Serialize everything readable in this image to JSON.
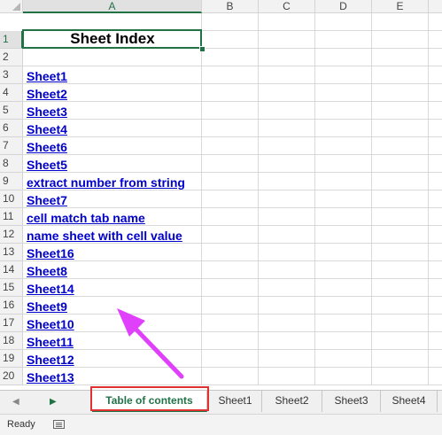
{
  "columns": [
    "A",
    "B",
    "C",
    "D",
    "E"
  ],
  "rows": [
    "1",
    "2",
    "3",
    "4",
    "5",
    "6",
    "7",
    "8",
    "9",
    "10",
    "11",
    "12",
    "13",
    "14",
    "15",
    "16",
    "17",
    "18",
    "19",
    "20"
  ],
  "title_cell": "Sheet Index",
  "links": [
    "Sheet1",
    "Sheet2",
    "Sheet3",
    "Sheet4",
    "Sheet6",
    "Sheet5",
    "extract number from string",
    "Sheet7",
    "cell match tab name",
    "name sheet with cell value",
    "Sheet16",
    "Sheet8",
    "Sheet14",
    "Sheet9",
    "Sheet10",
    "Sheet11",
    "Sheet12",
    "Sheet13"
  ],
  "tabs": {
    "active": "Table of contents",
    "others": [
      "Sheet1",
      "Sheet2",
      "Sheet3",
      "Sheet4"
    ]
  },
  "nav_arrows": {
    "prev": "◀",
    "next": "▶"
  },
  "status": {
    "text": "Ready",
    "icon": "page-layout-icon"
  },
  "colors": {
    "accent": "#217346",
    "link": "#0000cc",
    "highlight_box": "#e03131",
    "arrow": "#e040fb"
  }
}
